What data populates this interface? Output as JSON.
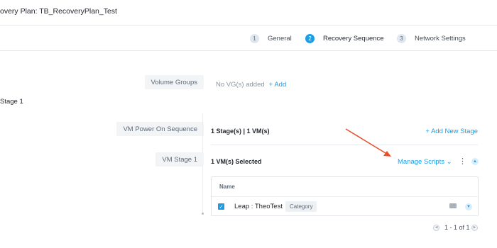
{
  "header": {
    "title": "overy Plan: TB_RecoveryPlan_Test"
  },
  "wizard": {
    "steps": [
      {
        "num": "1",
        "label": "General",
        "state": "inactive"
      },
      {
        "num": "2",
        "label": "Recovery Sequence",
        "state": "active"
      },
      {
        "num": "3",
        "label": "Network Settings",
        "state": "inactive"
      }
    ]
  },
  "stage_heading": "Stage 1",
  "volume_groups": {
    "label": "Volume Groups",
    "empty_text": "No VG(s) added",
    "add_link": "+ Add"
  },
  "power_on": {
    "label": "VM Power On Sequence",
    "summary": "1 Stage(s) | 1 VM(s)",
    "add_stage_link": "+ Add New Stage"
  },
  "vm_stage": {
    "label": "VM Stage 1",
    "selected_text": "1 VM(s) Selected",
    "manage_scripts": "Manage Scripts",
    "manage_scripts_chevron": "⌄",
    "more_glyph": "⋮",
    "collapse_glyph": "▲"
  },
  "vm_table": {
    "header": "Name",
    "rows": [
      {
        "checked": "✓",
        "name": "Leap : TheoTest",
        "badge": "Category",
        "expand_glyph": "▼"
      }
    ]
  },
  "pagination": {
    "prev_glyph": "◀",
    "text": "1 - 1 of 1",
    "next_glyph": "▶"
  },
  "annotation": {
    "arrow_color": "#e8502b"
  },
  "colors": {
    "accent": "#1b9ee7",
    "text": "#22272e",
    "muted": "#8a96a3"
  }
}
